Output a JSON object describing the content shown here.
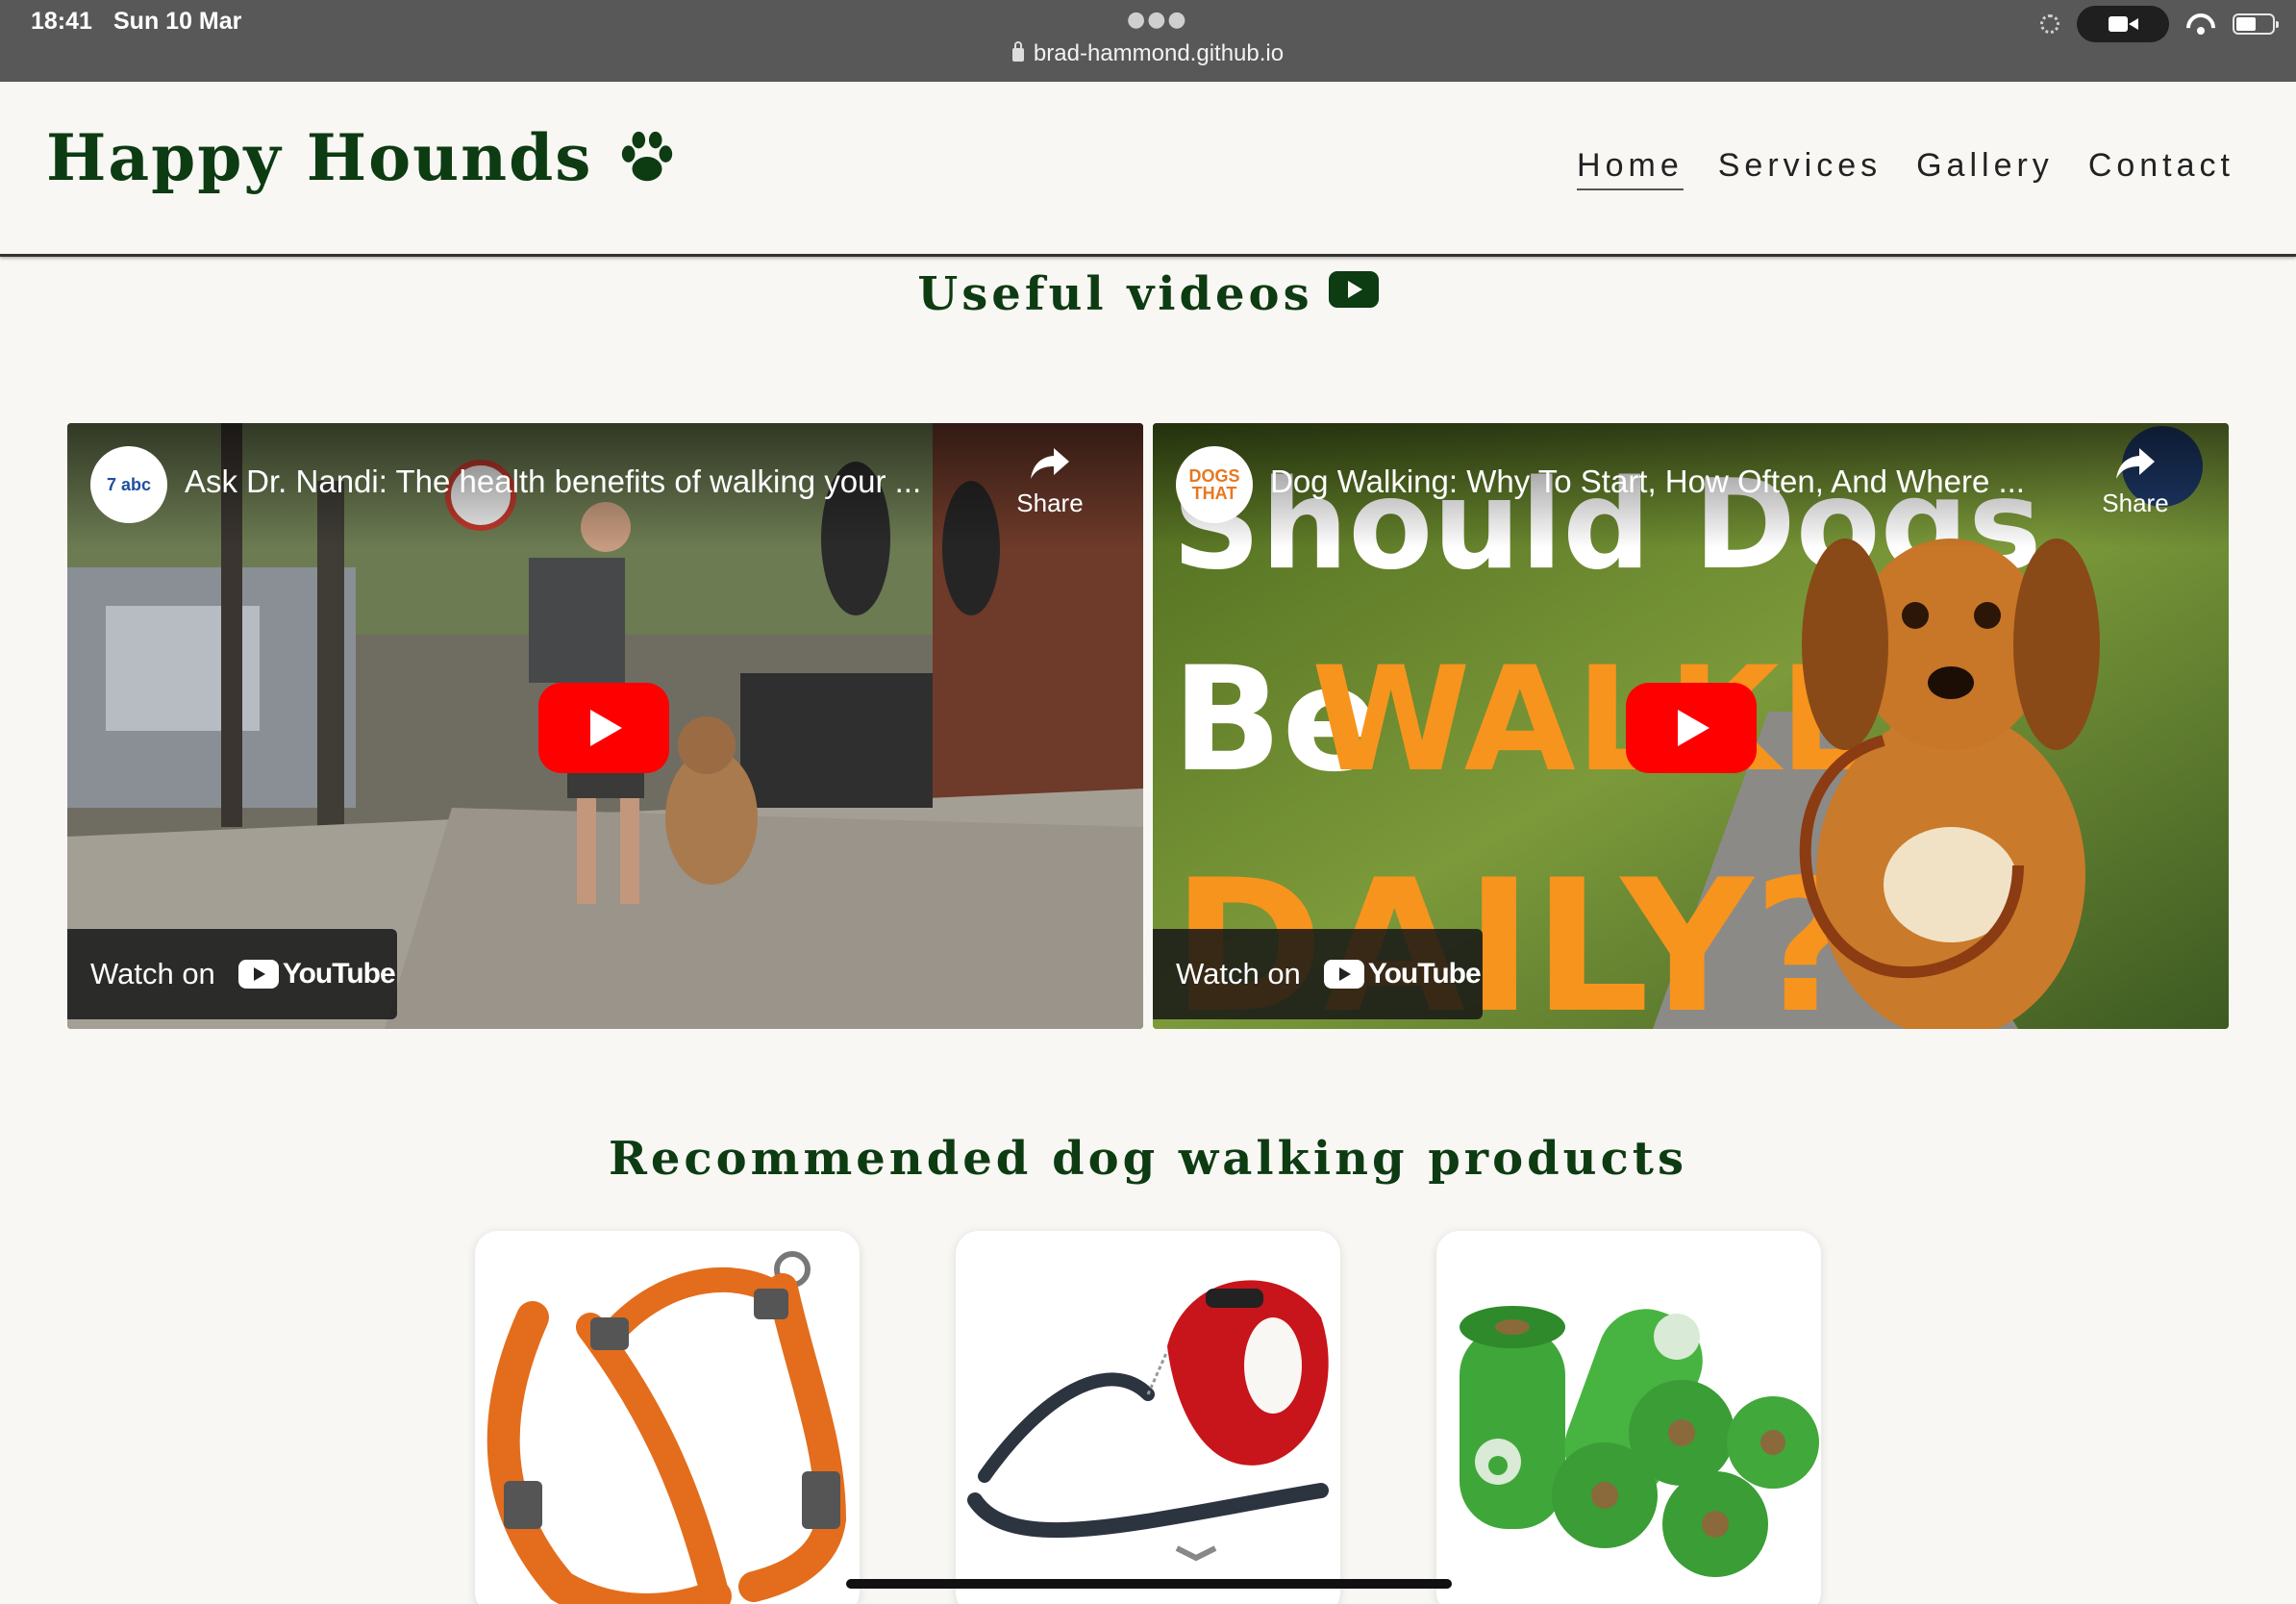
{
  "status_bar": {
    "time": "18:41",
    "date": "Sun 10 Mar",
    "url": "brad-hammond.github.io"
  },
  "site": {
    "brand": "Happy Hounds",
    "brand_icon": "paw-icon",
    "colors": {
      "brand_green": "#0d3b12",
      "background": "#f8f7f3"
    },
    "nav": [
      {
        "label": "Home",
        "active": true
      },
      {
        "label": "Services",
        "active": false
      },
      {
        "label": "Gallery",
        "active": false
      },
      {
        "label": "Contact",
        "active": false
      }
    ]
  },
  "videos_section": {
    "title": "Useful videos",
    "icon": "youtube-icon",
    "videos": [
      {
        "channel": "7 abc",
        "title": "Ask Dr. Nandi: The health benefits of walking your ...",
        "share_label": "Share",
        "watch_on": "Watch on",
        "platform": "YouTube"
      },
      {
        "channel": "DOGS THAT",
        "title": "Dog Walking: Why To Start, How Often, And Where ...",
        "thumbnail_text": [
          "Should Dogs",
          "Be",
          "WALKED",
          "DAILY?"
        ],
        "share_label": "Share",
        "watch_on": "Watch on",
        "platform": "YouTube"
      }
    ]
  },
  "products_section": {
    "title": "Recommended dog walking products",
    "products": [
      {
        "name": "orange-dog-harness"
      },
      {
        "name": "red-retractable-leash"
      },
      {
        "name": "green-poop-bag-rolls"
      }
    ]
  }
}
